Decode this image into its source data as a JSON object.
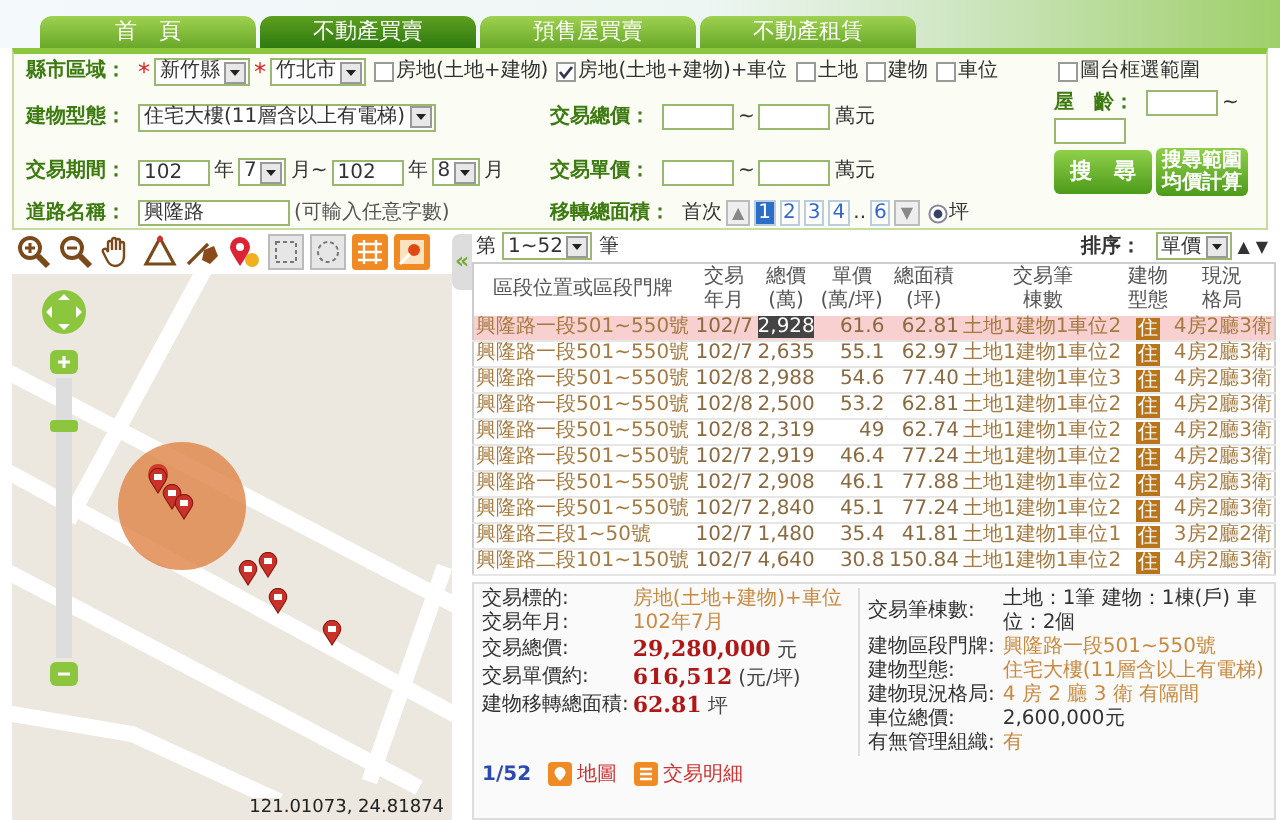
{
  "nav_tabs": [
    {
      "label": "首　頁",
      "selected": false
    },
    {
      "label": "不動產買賣",
      "selected": true
    },
    {
      "label": "預售屋買賣",
      "selected": false
    },
    {
      "label": "不動產租賃",
      "selected": false
    }
  ],
  "search_form": {
    "rows": [
      {
        "left": [
          {
            "kind": "label",
            "text": "縣市區域："
          },
          {
            "kind": "required",
            "text": "*"
          },
          {
            "kind": "select",
            "value": "新竹縣"
          },
          {
            "kind": "required",
            "text": "*"
          },
          {
            "kind": "select",
            "value": "竹北市"
          },
          {
            "kind": "checkbox",
            "label": "房地(土地+建物)",
            "checked": false
          },
          {
            "kind": "checkbox",
            "label": "房地(土地+建物)+車位",
            "checked": true
          },
          {
            "kind": "checkbox",
            "label": "土地",
            "checked": false
          },
          {
            "kind": "checkbox",
            "label": "建物",
            "checked": false
          },
          {
            "kind": "checkbox",
            "label": "車位",
            "checked": false
          }
        ],
        "right": [
          {
            "kind": "checkbox",
            "label": "圖台框選範圍",
            "checked": false
          }
        ]
      },
      {
        "left": [
          {
            "kind": "label",
            "text": "建物型態："
          },
          {
            "kind": "select",
            "value": "住宅大樓(11層含以上有電梯)"
          }
        ],
        "middle": [
          {
            "kind": "label",
            "text": "交易總價："
          },
          {
            "kind": "input"
          },
          {
            "kind": "text",
            "text": "~"
          },
          {
            "kind": "input"
          },
          {
            "kind": "text",
            "text": "萬元"
          }
        ],
        "right": [
          {
            "kind": "label",
            "text": "屋　齡："
          },
          {
            "kind": "input"
          },
          {
            "kind": "text",
            "text": "~"
          },
          {
            "kind": "input"
          }
        ]
      },
      {
        "left": [
          {
            "kind": "label",
            "text": "交易期間："
          },
          {
            "kind": "input",
            "value": "102"
          },
          {
            "kind": "text",
            "text": "年"
          },
          {
            "kind": "select",
            "value": "7"
          },
          {
            "kind": "text",
            "text": "月~"
          },
          {
            "kind": "input",
            "value": "102"
          },
          {
            "kind": "text",
            "text": "年"
          },
          {
            "kind": "select",
            "value": "8"
          },
          {
            "kind": "text",
            "text": "月"
          }
        ],
        "middle": [
          {
            "kind": "label",
            "text": "交易單價："
          },
          {
            "kind": "input"
          },
          {
            "kind": "text",
            "text": "~"
          },
          {
            "kind": "input"
          },
          {
            "kind": "text",
            "text": "萬元"
          }
        ],
        "right": [
          {
            "kind": "button",
            "text": "搜　尋"
          },
          {
            "kind": "button2",
            "text": "搜尋範圍均價計算"
          }
        ]
      },
      {
        "left": [
          {
            "kind": "label",
            "text": "道路名稱："
          },
          {
            "kind": "text-input",
            "value": "興隆路"
          },
          {
            "kind": "hint",
            "text": "(可輸入任意字數)"
          }
        ],
        "middle": [
          {
            "kind": "label",
            "text": "移轉總面積："
          },
          {
            "kind": "text",
            "text": "首次"
          },
          {
            "kind": "arrow",
            "text": "▲"
          },
          {
            "kind": "page",
            "text": "1",
            "selected": true
          },
          {
            "kind": "page",
            "text": "2",
            "selected": false
          },
          {
            "kind": "page",
            "text": "3",
            "selected": false
          },
          {
            "kind": "page",
            "text": "4",
            "selected": false
          },
          {
            "kind": "text",
            "text": ".."
          },
          {
            "kind": "page",
            "text": "6",
            "selected": false
          },
          {
            "kind": "arrow",
            "text": "▼"
          },
          {
            "kind": "radio",
            "label": "坪",
            "selected": true
          }
        ]
      }
    ]
  },
  "map": {
    "coordinates": "121.01073, 24.81874",
    "zoom": {
      "level": 0.85
    }
  },
  "results": {
    "range_prefix": "第",
    "range": "1~52",
    "range_suffix": "筆",
    "sort_label": "排序：",
    "sort_value": "單價",
    "sort_arrows": [
      "▲",
      "▼"
    ],
    "collapse": "«",
    "columns": [
      "區段位置或區段門牌",
      "交易年月",
      "總價(萬)",
      "單價(萬/坪)",
      "總面積(坪)",
      "交易筆棟數",
      "建物型態",
      "現況格局"
    ],
    "rows": [
      {
        "selected": true,
        "cells": [
          "興隆路一段501~550號",
          "102/7",
          "2,928",
          "61.6",
          "62.81",
          "土地1建物1車位2",
          "住",
          "4房2廳3衛"
        ]
      },
      {
        "selected": false,
        "cells": [
          "興隆路一段501~550號",
          "102/7",
          "2,635",
          "55.1",
          "62.97",
          "土地1建物1車位2",
          "住",
          "4房2廳3衛"
        ]
      },
      {
        "selected": false,
        "cells": [
          "興隆路一段501~550號",
          "102/8",
          "2,988",
          "54.6",
          "77.40",
          "土地1建物1車位3",
          "住",
          "4房2廳3衛"
        ]
      },
      {
        "selected": false,
        "cells": [
          "興隆路一段501~550號",
          "102/8",
          "2,500",
          "53.2",
          "62.81",
          "土地1建物1車位2",
          "住",
          "4房2廳3衛"
        ]
      },
      {
        "selected": false,
        "cells": [
          "興隆路一段501~550號",
          "102/8",
          "2,319",
          "49",
          "62.74",
          "土地1建物1車位2",
          "住",
          "4房2廳3衛"
        ]
      },
      {
        "selected": false,
        "cells": [
          "興隆路一段501~550號",
          "102/7",
          "2,919",
          "46.4",
          "77.24",
          "土地1建物1車位2",
          "住",
          "4房2廳3衛"
        ]
      },
      {
        "selected": false,
        "cells": [
          "興隆路一段501~550號",
          "102/7",
          "2,908",
          "46.1",
          "77.88",
          "土地1建物1車位2",
          "住",
          "4房2廳3衛"
        ]
      },
      {
        "selected": false,
        "cells": [
          "興隆路一段501~550號",
          "102/7",
          "2,840",
          "45.1",
          "77.24",
          "土地1建物1車位2",
          "住",
          "4房2廳3衛"
        ]
      },
      {
        "selected": false,
        "cells": [
          "興隆路三段1~50號",
          "102/7",
          "1,480",
          "35.4",
          "41.81",
          "土地1建物1車位1",
          "住",
          "3房2廳2衛"
        ]
      },
      {
        "selected": false,
        "cells": [
          "興隆路二段101~150號",
          "102/7",
          "4,640",
          "30.8",
          "150.84",
          "土地1建物1車位2",
          "住",
          "4房2廳3衛"
        ]
      }
    ]
  },
  "detail": {
    "left": [
      {
        "label": "交易標的:",
        "value": "房地(土地+建物)+車位",
        "kind": "plain"
      },
      {
        "label": "交易年月:",
        "value": "102年7月",
        "kind": "plain"
      },
      {
        "label": "交易總價:",
        "value": "29,280,000",
        "unit": "元",
        "kind": "emphasis"
      },
      {
        "label": "交易單價約:",
        "value": "616,512",
        "unit": "(元/坪)",
        "kind": "emphasis"
      },
      {
        "label": "建物移轉總面積:",
        "value": "62.81",
        "unit": "坪",
        "kind": "emphasis"
      }
    ],
    "right": [
      {
        "label": "交易筆棟數:",
        "value": "土地：1筆 建物：1棟(戶) 車位：2個",
        "kind": "small"
      },
      {
        "label": "建物區段門牌:",
        "value": "興隆路一段501~550號",
        "kind": "plain"
      },
      {
        "label": "建物型態:",
        "value": "住宅大樓(11層含以上有電梯)",
        "kind": "plain"
      },
      {
        "label": "建物現況格局:",
        "value": "4 房 2 廳 3 衛 有隔間",
        "kind": "plain"
      },
      {
        "label": "車位總價:",
        "value": "2,600,000元",
        "kind": "small"
      },
      {
        "label": "有無管理組織:",
        "value": "有",
        "kind": "plain"
      }
    ],
    "counter": "1/52",
    "links": [
      {
        "kind": "map",
        "label": "地圖"
      },
      {
        "kind": "detail",
        "label": "交易明細"
      }
    ]
  }
}
